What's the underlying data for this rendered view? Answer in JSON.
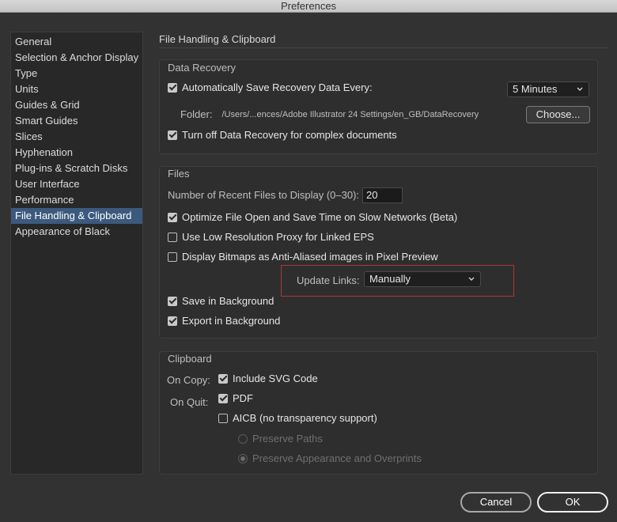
{
  "window": {
    "title": "Preferences"
  },
  "sidebar": {
    "items": [
      {
        "label": "General"
      },
      {
        "label": "Selection & Anchor Display"
      },
      {
        "label": "Type"
      },
      {
        "label": "Units"
      },
      {
        "label": "Guides & Grid"
      },
      {
        "label": "Smart Guides"
      },
      {
        "label": "Slices"
      },
      {
        "label": "Hyphenation"
      },
      {
        "label": "Plug-ins & Scratch Disks"
      },
      {
        "label": "User Interface"
      },
      {
        "label": "Performance"
      },
      {
        "label": "File Handling & Clipboard",
        "selected": true
      },
      {
        "label": "Appearance of Black"
      }
    ]
  },
  "main": {
    "heading": "File Handling & Clipboard",
    "data_recovery": {
      "title": "Data Recovery",
      "auto_save": {
        "label": "Automatically Save Recovery Data Every:",
        "checked": true
      },
      "interval": {
        "value": "5 Minutes"
      },
      "folder": {
        "label": "Folder:",
        "path": "/Users/...ences/Adobe Illustrator 24 Settings/en_GB/DataRecovery"
      },
      "choose_button": "Choose...",
      "turn_off": {
        "label": "Turn off Data Recovery for complex documents",
        "checked": true
      }
    },
    "files": {
      "title": "Files",
      "recent_files": {
        "label": "Number of Recent Files to Display (0–30):",
        "value": "20"
      },
      "optimize": {
        "label": "Optimize File Open and Save Time on Slow Networks (Beta)",
        "checked": true
      },
      "low_res_proxy": {
        "label": "Use Low Resolution Proxy for Linked EPS",
        "checked": false
      },
      "anti_aliased": {
        "label": "Display Bitmaps as Anti-Aliased images in Pixel Preview",
        "checked": false
      },
      "update_links": {
        "label": "Update Links:",
        "value": "Manually"
      },
      "save_background": {
        "label": "Save in Background",
        "checked": true
      },
      "export_background": {
        "label": "Export in Background",
        "checked": true
      }
    },
    "clipboard": {
      "title": "Clipboard",
      "on_copy_label": "On Copy:",
      "on_quit_label": "On Quit:",
      "include_svg": {
        "label": "Include SVG Code",
        "checked": true
      },
      "pdf": {
        "label": "PDF",
        "checked": true
      },
      "aicb": {
        "label": "AICB (no transparency support)",
        "checked": false
      },
      "preserve_paths": {
        "label": "Preserve Paths",
        "selected": false,
        "enabled": false
      },
      "preserve_appearance": {
        "label": "Preserve Appearance and Overprints",
        "selected": true,
        "enabled": false
      }
    }
  },
  "footer": {
    "cancel_label": "Cancel",
    "ok_label": "OK"
  },
  "colors": {
    "background": "#323232",
    "selection": "#3c5a7e",
    "highlight_border": "#b23434"
  }
}
